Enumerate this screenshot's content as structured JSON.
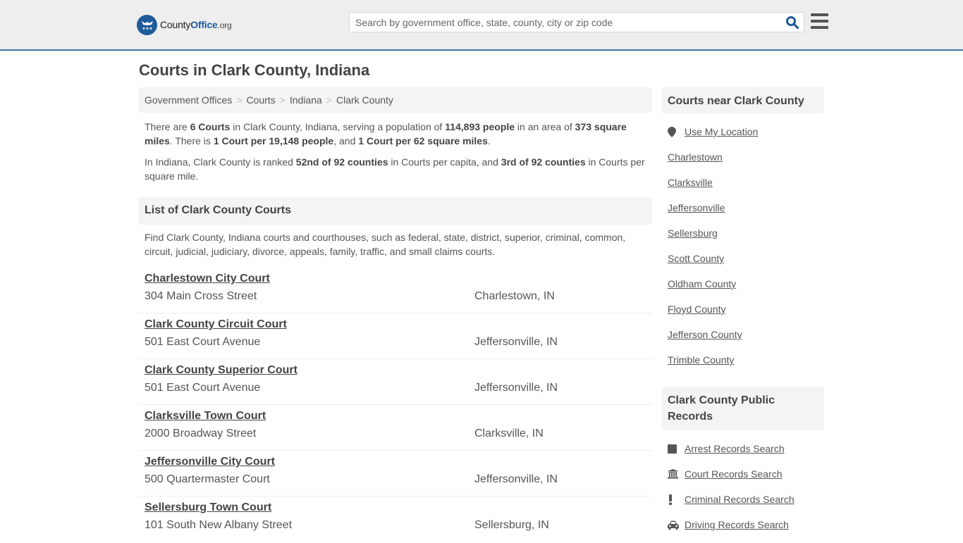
{
  "header": {
    "logo": {
      "name": "County",
      "accent": "Office",
      "tld": ".org"
    },
    "search": {
      "placeholder": "Search by government office, state, county, city or zip code",
      "value": ""
    },
    "colors": {
      "brand": "#1f5a9b",
      "header_border": "#3b77a8",
      "header_bg": "#eeeeee"
    }
  },
  "page": {
    "title": "Courts in Clark County, Indiana",
    "breadcrumb": [
      "Government Offices",
      "Courts",
      "Indiana",
      "Clark County"
    ],
    "breadcrumb_separator": ">"
  },
  "intro": {
    "p1": {
      "t1": "There are ",
      "b1": "6 Courts",
      "t2": " in Clark County, Indiana, serving a population of ",
      "b2": "114,893 people",
      "t3": " in an area of ",
      "b3": "373 square miles",
      "t4": ". There is ",
      "b4": "1 Court per 19,148 people",
      "t5": ", and ",
      "b5": "1 Court per 62 square miles",
      "t6": "."
    },
    "p2": {
      "t1": "In Indiana, Clark County is ranked ",
      "b1": "52nd of 92 counties",
      "t2": " in Courts per capita, and ",
      "b2": "3rd of 92 counties",
      "t3": " in Courts per square mile."
    }
  },
  "list": {
    "heading": "List of Clark County Courts",
    "description": "Find Clark County, Indiana courts and courthouses, such as federal, state, district, superior, criminal, common, circuit, judicial, judiciary, divorce, appeals, family, traffic, and small claims courts.",
    "courts": [
      {
        "name": "Charlestown City Court",
        "address": "304 Main Cross Street",
        "city": "Charlestown, IN"
      },
      {
        "name": "Clark County Circuit Court",
        "address": "501 East Court Avenue",
        "city": "Jeffersonville, IN"
      },
      {
        "name": "Clark County Superior Court",
        "address": "501 East Court Avenue",
        "city": "Jeffersonville, IN"
      },
      {
        "name": "Clarksville Town Court",
        "address": "2000 Broadway Street",
        "city": "Clarksville, IN"
      },
      {
        "name": "Jeffersonville City Court",
        "address": "500 Quartermaster Court",
        "city": "Jeffersonville, IN"
      },
      {
        "name": "Sellersburg Town Court",
        "address": "101 South New Albany Street",
        "city": "Sellersburg, IN"
      }
    ]
  },
  "sidebar": {
    "near": {
      "heading": "Courts near Clark County",
      "use_location": {
        "label": "Use My Location",
        "icon": "map-marker-icon"
      },
      "links": [
        "Charlestown",
        "Clarksville",
        "Jeffersonville",
        "Sellersburg",
        "Scott County",
        "Oldham County",
        "Floyd County",
        "Jefferson County",
        "Trimble County"
      ]
    },
    "records": {
      "heading": "Clark County Public Records",
      "links": [
        {
          "label": "Arrest Records Search",
          "icon": "square-icon"
        },
        {
          "label": "Court Records Search",
          "icon": "courthouse-icon"
        },
        {
          "label": "Criminal Records Search",
          "icon": "exclamation-icon"
        },
        {
          "label": "Driving Records Search",
          "icon": "car-icon"
        }
      ]
    }
  }
}
